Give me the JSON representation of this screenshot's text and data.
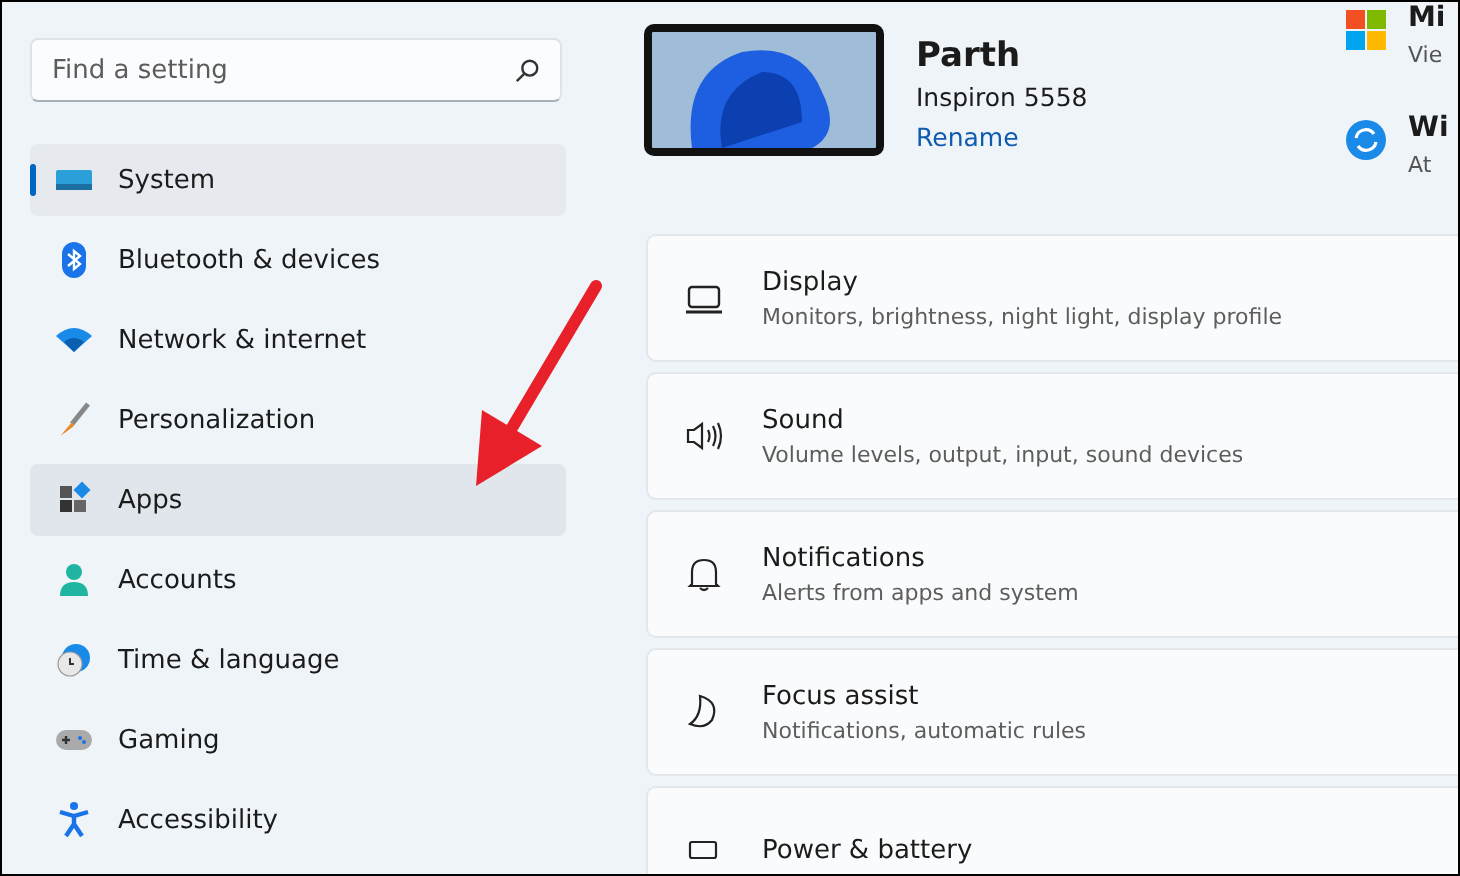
{
  "search": {
    "placeholder": "Find a setting"
  },
  "nav": [
    {
      "label": "System",
      "selected": true,
      "hovered": false
    },
    {
      "label": "Bluetooth & devices",
      "selected": false,
      "hovered": false
    },
    {
      "label": "Network & internet",
      "selected": false,
      "hovered": false
    },
    {
      "label": "Personalization",
      "selected": false,
      "hovered": false
    },
    {
      "label": "Apps",
      "selected": false,
      "hovered": true
    },
    {
      "label": "Accounts",
      "selected": false,
      "hovered": false
    },
    {
      "label": "Time & language",
      "selected": false,
      "hovered": false
    },
    {
      "label": "Gaming",
      "selected": false,
      "hovered": false
    },
    {
      "label": "Accessibility",
      "selected": false,
      "hovered": false
    }
  ],
  "device": {
    "name": "Parth",
    "model": "Inspiron 5558",
    "rename": "Rename"
  },
  "side_info": [
    {
      "title": "Mi",
      "lines": [
        "Vie"
      ]
    },
    {
      "title": "Wi",
      "lines": [
        "At"
      ]
    }
  ],
  "cards": [
    {
      "title": "Display",
      "subtitle": "Monitors, brightness, night light, display profile"
    },
    {
      "title": "Sound",
      "subtitle": "Volume levels, output, input, sound devices"
    },
    {
      "title": "Notifications",
      "subtitle": "Alerts from apps and system"
    },
    {
      "title": "Focus assist",
      "subtitle": "Notifications, automatic rules"
    },
    {
      "title": "Power & battery"
    }
  ]
}
